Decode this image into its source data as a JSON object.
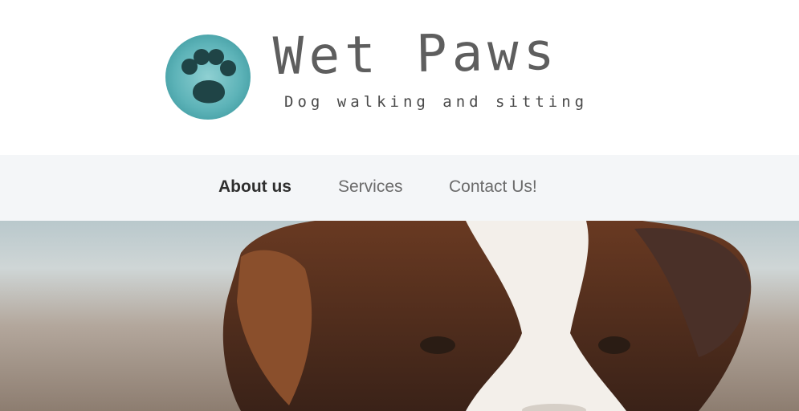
{
  "brand": {
    "name": "Wet Paws",
    "tagline": "Dog walking and sitting",
    "accent_color": "#5db3b8"
  },
  "nav": {
    "items": [
      {
        "label": "About us",
        "active": true
      },
      {
        "label": "Services",
        "active": false
      },
      {
        "label": "Contact Us!",
        "active": false
      }
    ]
  },
  "hero": {
    "image": "dog-photo"
  }
}
